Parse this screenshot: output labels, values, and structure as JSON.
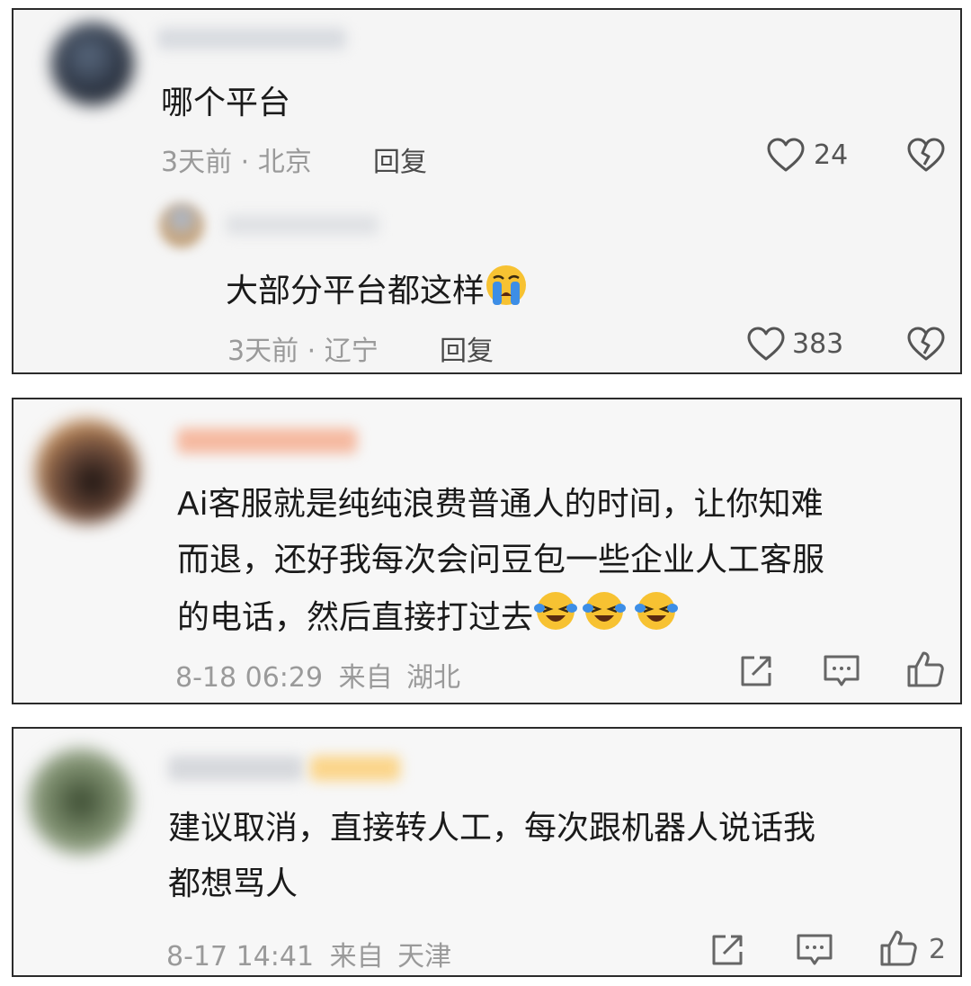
{
  "comments": [
    {
      "text": "哪个平台",
      "time": "3天前",
      "separator": " · ",
      "location": "北京",
      "reply_label": "回复",
      "like_count": "24",
      "replies": [
        {
          "text": "大部分平台都这样",
          "emoji": "crying-face",
          "time": "3天前",
          "separator": " · ",
          "location": "辽宁",
          "reply_label": "回复",
          "like_count": "383"
        }
      ]
    },
    {
      "lines": [
        "Ai客服就是纯纯浪费普通人的时间，让你知难",
        "而退，还好我每次会问豆包一些企业人工客服",
        "的电话，然后直接打过去"
      ],
      "emojis": [
        "laughing-crying-face",
        "laughing-crying-face",
        "laughing-crying-face"
      ],
      "date": "8-18 06:29",
      "from_label": "来自",
      "location": "湖北"
    },
    {
      "lines": [
        "建议取消，直接转人工，每次跟机器人说话我",
        "都想骂人"
      ],
      "date": "8-17 14:41",
      "from_label": "来自",
      "location": "天津",
      "like_count": "2"
    }
  ],
  "colors": {
    "text": "#1a1a1a",
    "meta": "#9a9a9a",
    "icon": "#555555",
    "emoji_yellow": "#f7c232",
    "emoji_tear": "#3d8ee6",
    "border": "#2b2b2b"
  }
}
